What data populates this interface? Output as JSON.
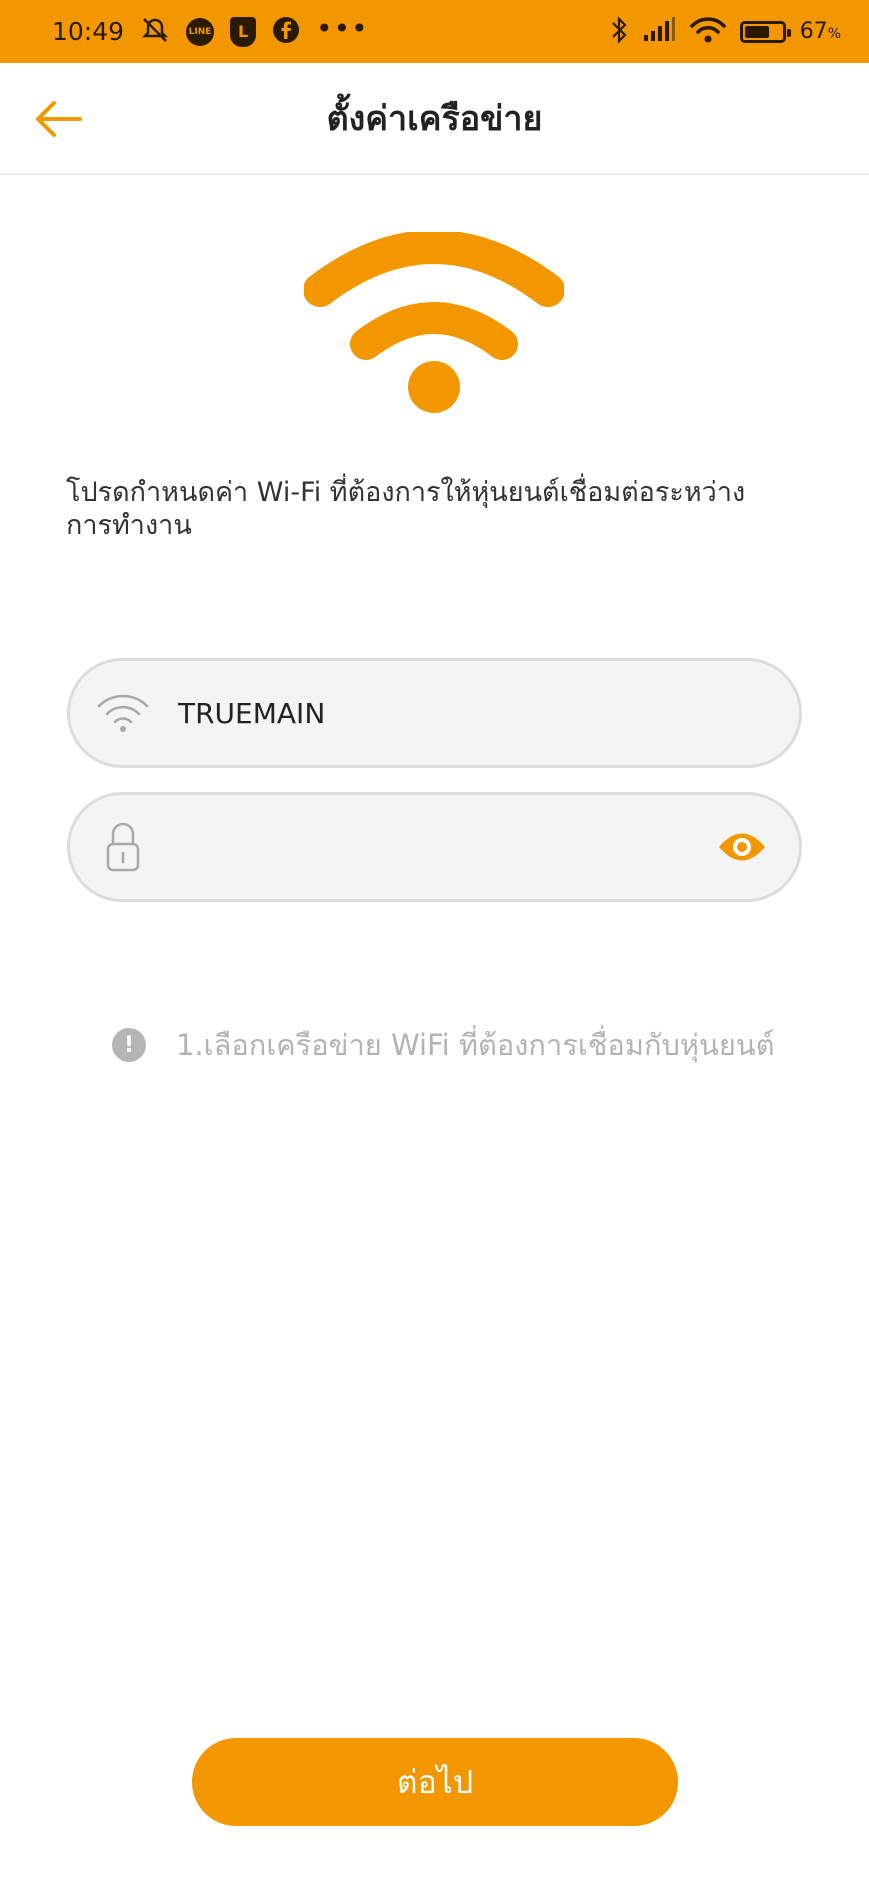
{
  "status_bar": {
    "time": "10:49",
    "line_label": "LINE",
    "l_label": "L",
    "more": "•••",
    "battery_pct": "67",
    "battery_unit": "%",
    "battery_level": 0.67
  },
  "header": {
    "title": "ตั้งค่าเครือข่าย"
  },
  "main": {
    "description": "โปรดกำหนดค่า Wi-Fi ที่ต้องการให้หุ่นยนต์เชื่อมต่อระหว่างการทำงาน",
    "ssid_value": "TRUEMAIN",
    "password_value": "",
    "hint_text": "1.เลือกเครือข่าย WiFi ที่ต้องการเชื่อมกับหุ่นยนต์",
    "hint_mark": "!",
    "next_label": "ต่อไป"
  },
  "colors": {
    "accent": "#F39700",
    "field_bg": "#f4f4f4",
    "hint_gray": "#b3b3b3"
  },
  "icons": {
    "back": "arrow-left-icon",
    "hero": "wifi-icon",
    "ssid": "wifi-icon",
    "password": "lock-icon",
    "visibility": "eye-icon",
    "hint": "exclamation-circle-icon"
  }
}
